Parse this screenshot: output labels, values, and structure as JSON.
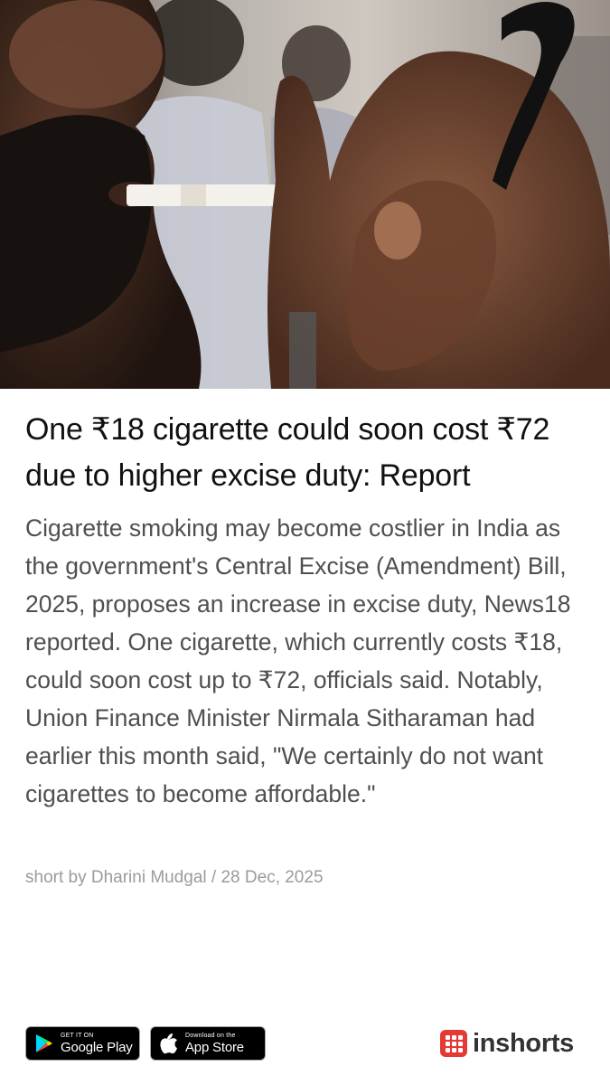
{
  "article": {
    "image_alt": "Man smoking a cigarette while lighting it",
    "headline": "One ₹18 cigarette could soon cost ₹72 due to higher excise duty: Report",
    "body": "Cigarette smoking may become costlier in India as the government's Central Excise (Amendment) Bill, 2025, proposes an increase in excise duty, News18 reported. One cigarette, which currently costs ₹18, could soon cost up to ₹72, officials said. Notably, Union Finance Minister Nirmala Sitharaman had earlier this month said, \"We certainly do not want cigarettes to become affordable.\"",
    "byline": "short by Dharini Mudgal / 28 Dec, 2025"
  },
  "footer": {
    "google_play": {
      "small": "GET IT ON",
      "big": "Google Play",
      "icon": "google-play-icon"
    },
    "app_store": {
      "small": "Download on the",
      "big": "App Store",
      "icon": "apple-icon"
    },
    "brand": {
      "name": "inshorts",
      "color": "#e53935"
    }
  }
}
